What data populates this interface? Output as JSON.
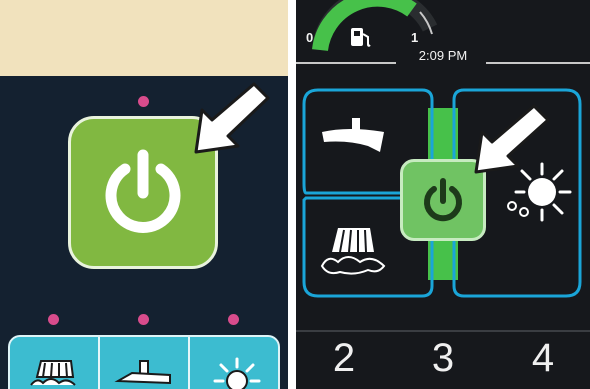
{
  "gauge": {
    "min_label": "0",
    "max_label": "1",
    "fill_fraction": 0.72,
    "fuel_icon": "fuel-pump-icon"
  },
  "clock": {
    "time": "2:09 PM"
  },
  "mode_numbers": [
    "2",
    "3",
    "4"
  ],
  "left_modes": [
    "brush-scrub-icon",
    "squeegee-icon",
    "splash-wash-icon"
  ],
  "right_modes": [
    "squeegee-icon",
    "brush-scrub-icon",
    "splash-wash-icon"
  ],
  "colors": {
    "left_background": "#142130",
    "left_header": "#f1e2bd",
    "left_power": "#81b841",
    "pink_indicator": "#d84c8c",
    "mode_bar": "#3cbcd0",
    "right_background": "#16181c",
    "right_power": "#70c363",
    "outline_blue": "#1aa5d8",
    "gauge_green": "#47c14a"
  }
}
